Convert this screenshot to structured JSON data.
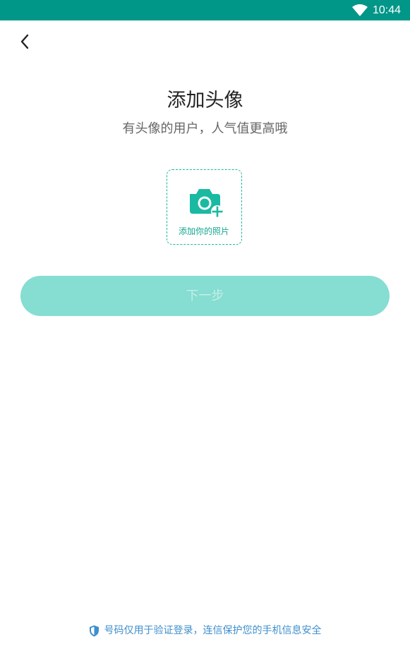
{
  "status_bar": {
    "time": "10:44",
    "wifi_icon": "wifi-icon",
    "background_color": "#009688"
  },
  "header": {
    "back_icon": "chevron-left-icon"
  },
  "main": {
    "title": "添加头像",
    "subtitle": "有头像的用户，人气值更高哦",
    "avatar_upload": {
      "icon": "camera-plus-icon",
      "label": "添加你的照片",
      "accent_color": "#1ab9a2"
    },
    "next_button": {
      "label": "下一步",
      "state": "disabled",
      "color": "#86ddd2"
    }
  },
  "footer": {
    "security_icon": "shield-icon",
    "security_text": "号码仅用于验证登录，连信保护您的手机信息安全",
    "text_color": "#3f8fcc"
  }
}
